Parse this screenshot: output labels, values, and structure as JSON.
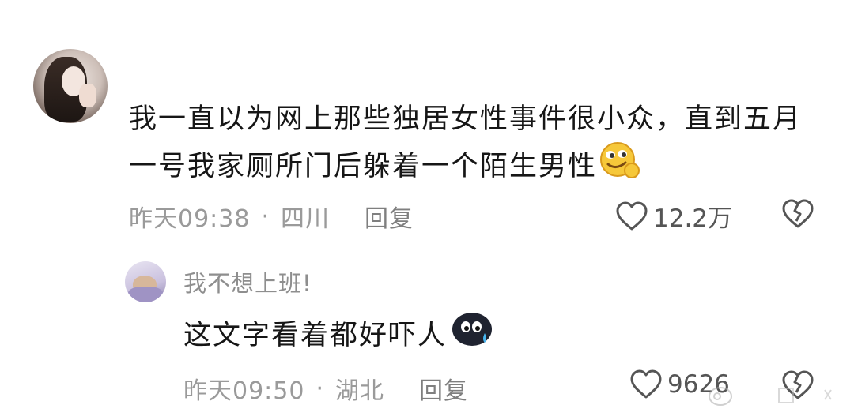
{
  "main_comment": {
    "text": "我一直以为网上那些独居女性事件很小众，直到五月一号我家厕所门后躲着一个陌生男性",
    "emoji": "smirk-face-emoji",
    "time": "昨天09:38",
    "separator": "·",
    "location": "四川",
    "reply_label": "回复",
    "like_count": "12.2万"
  },
  "reply": {
    "username": "我不想上班!",
    "text": "这文字看着都好吓人",
    "emoji": "scared-black-blob-emoji",
    "time": "昨天09:50",
    "separator": "·",
    "location": "湖北",
    "reply_label": "回复",
    "like_count": "9626"
  },
  "icons": {
    "like": "heart-outline-icon",
    "dislike": "broken-heart-outline-icon"
  },
  "colors": {
    "primary_text": "#161616",
    "meta_text": "#9a9a9a",
    "emoji_yellow": "#f6c83a"
  }
}
